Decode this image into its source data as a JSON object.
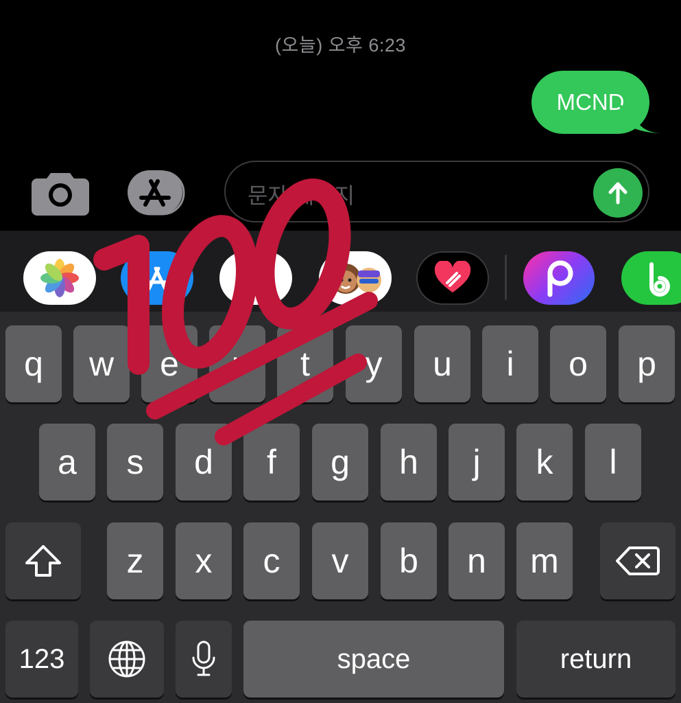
{
  "conversation": {
    "timestamp": "(오늘) 오후 6:23",
    "messages": [
      {
        "text": "MCND",
        "sender": "me"
      }
    ]
  },
  "composer": {
    "camera_icon": "camera-icon",
    "appstore_icon": "app-store-icon",
    "placeholder": "문자 메시지",
    "send_icon": "arrow-up-icon"
  },
  "app_drawer": {
    "apps": [
      {
        "name": "photos-app",
        "icon": "photos-icon"
      },
      {
        "name": "app-store-app",
        "icon": "app-store-icon"
      },
      {
        "name": "music-app",
        "icon": "music-note-icon"
      },
      {
        "name": "memoji-app",
        "icon": "memoji-icon"
      },
      {
        "name": "digital-touch-app",
        "icon": "heart-touch-icon"
      },
      {
        "name": "picsart-app",
        "icon": "picsart-icon"
      },
      {
        "name": "band-app",
        "icon": "band-icon"
      }
    ]
  },
  "keyboard": {
    "row1": [
      "q",
      "w",
      "e",
      "r",
      "t",
      "y",
      "u",
      "i",
      "o",
      "p"
    ],
    "row2": [
      "a",
      "s",
      "d",
      "f",
      "g",
      "h",
      "j",
      "k",
      "l"
    ],
    "row3": [
      "z",
      "x",
      "c",
      "v",
      "b",
      "n",
      "m"
    ],
    "shift_icon": "shift-icon",
    "delete_icon": "delete-icon",
    "numbers_label": "123",
    "globe_icon": "globe-icon",
    "mic_icon": "microphone-icon",
    "space_label": "space",
    "return_label": "return"
  },
  "overlay": {
    "emoji": "hundred-points-emoji"
  },
  "colors": {
    "bubble_green": "#34c759",
    "send_green": "#30b451",
    "emoji_red": "#c0173a",
    "key": "#5f5f61",
    "keyboard_bg": "#2b2b2d"
  }
}
